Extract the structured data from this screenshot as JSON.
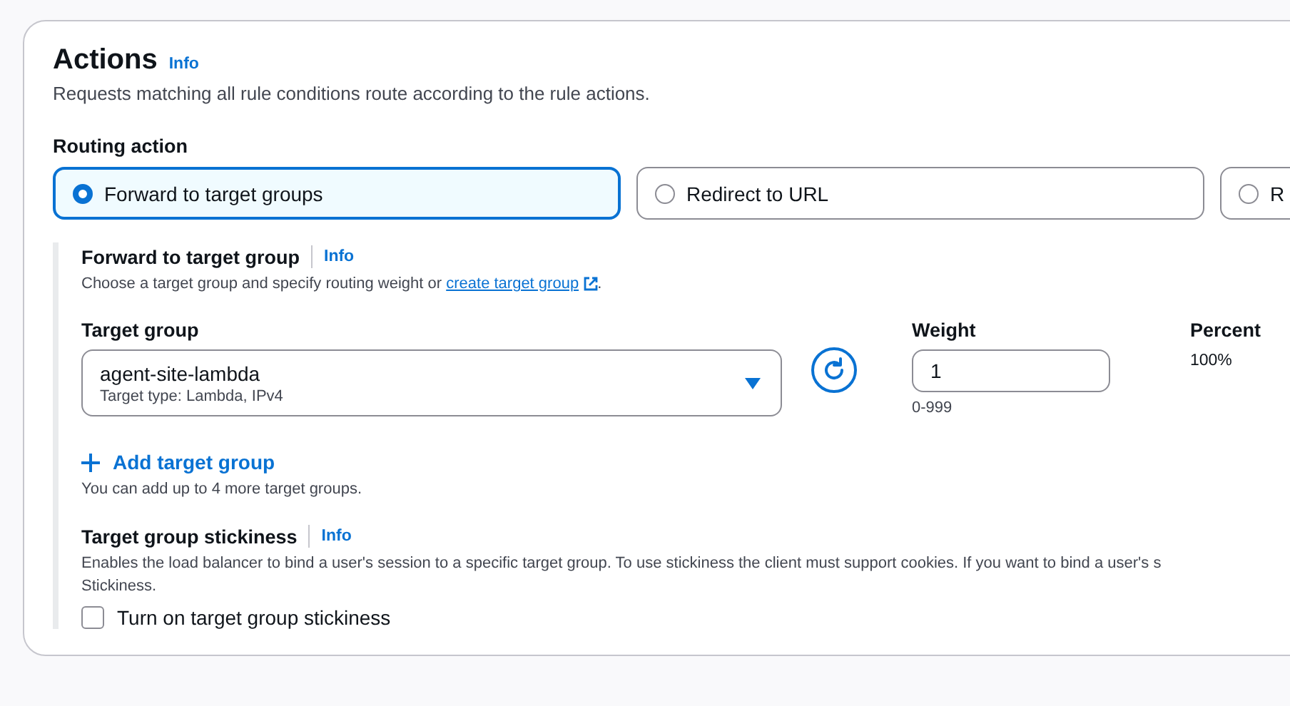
{
  "actions": {
    "title": "Actions",
    "info": "Info",
    "description": "Requests matching all rule conditions route according to the rule actions."
  },
  "routing_action": {
    "label": "Routing action",
    "options": [
      {
        "label": "Forward to target groups",
        "selected": true
      },
      {
        "label": "Redirect to URL",
        "selected": false
      },
      {
        "label": "R",
        "selected": false
      }
    ]
  },
  "forward": {
    "title": "Forward to target group",
    "info": "Info",
    "description_before": "Choose a target group and specify routing weight or ",
    "link": "create target group",
    "description_after": ".",
    "target_group": {
      "label": "Target group",
      "value": "agent-site-lambda",
      "detail": "Target type: Lambda, IPv4"
    },
    "weight": {
      "label": "Weight",
      "value": "1",
      "hint": "0-999"
    },
    "percent": {
      "label": "Percent",
      "value": "100%"
    },
    "add_button": "Add target group",
    "add_hint": "You can add up to 4 more target groups."
  },
  "stickiness": {
    "title": "Target group stickiness",
    "info": "Info",
    "description": [
      "Enables the load balancer to bind a user's session to a specific target group. To use stickiness the client must support cookies. If you want to bind a user's s",
      "Stickiness."
    ],
    "checkbox": {
      "label": "Turn on target group stickiness",
      "checked": false
    }
  }
}
